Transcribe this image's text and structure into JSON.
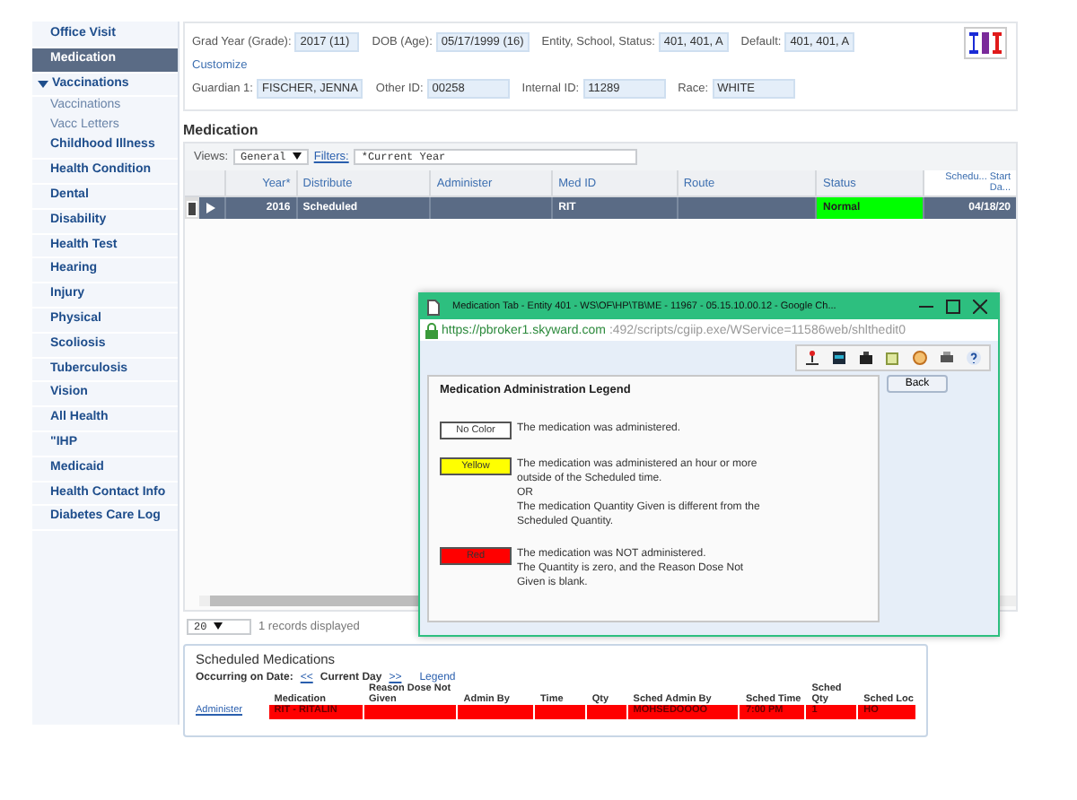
{
  "sidebar": {
    "items": [
      {
        "label": "Office Visit",
        "selected": false
      },
      {
        "label": "Medication",
        "selected": true
      },
      {
        "label": "Vaccinations",
        "selected": false,
        "expanded": true,
        "children": [
          {
            "label": "Vaccinations"
          },
          {
            "label": "Vacc Letters"
          }
        ]
      },
      {
        "label": "Childhood Illness",
        "selected": false
      },
      {
        "label": "Health Condition",
        "selected": false
      },
      {
        "label": "Dental",
        "selected": false
      },
      {
        "label": "Disability",
        "selected": false
      },
      {
        "label": "Health Test",
        "selected": false
      },
      {
        "label": "Hearing",
        "selected": false
      },
      {
        "label": "Injury",
        "selected": false
      },
      {
        "label": "Physical",
        "selected": false
      },
      {
        "label": "Scoliosis",
        "selected": false
      },
      {
        "label": "Tuberculosis",
        "selected": false
      },
      {
        "label": "Vision",
        "selected": false
      },
      {
        "label": "All Health",
        "selected": false
      },
      {
        "label": "\"IHP",
        "selected": false
      },
      {
        "label": "Medicaid",
        "selected": false
      },
      {
        "label": "Health Contact Info",
        "selected": false
      },
      {
        "label": "Diabetes Care Log",
        "selected": false
      }
    ]
  },
  "student": {
    "row_1": [
      {
        "label": "Grad Year (Grade):",
        "value": "2017 (11)"
      },
      {
        "label": "DOB (Age):",
        "value": "05/17/1999 (16)"
      },
      {
        "label": "Entity, School, Status:",
        "value": "401, 401, A"
      },
      {
        "label": "Default:",
        "value": "401, 401, A"
      }
    ],
    "customize": "Customize",
    "row_2": [
      {
        "label": "Guardian 1:",
        "value": "FISCHER, JENNA"
      },
      {
        "label": "Other ID:",
        "value": "00258"
      },
      {
        "label": "Internal ID:",
        "value": "11289"
      },
      {
        "label": "Race:",
        "value": "WHITE"
      }
    ]
  },
  "medication": {
    "title": "Medication",
    "views_label": "Views:",
    "view": "General",
    "filters_label": "Filters:",
    "filter": "*Current Year",
    "columns": [
      "Year*",
      "Distribute",
      "Administer",
      "Med ID",
      "Route",
      "Status",
      "Schedu... Start Da..."
    ],
    "rows": [
      {
        "selected": true,
        "cells": [
          {
            "text": "2016"
          },
          {
            "text": "Scheduled"
          },
          {
            "text": ""
          },
          {
            "text": "RIT"
          },
          {
            "text": ""
          },
          {
            "text": "Normal",
            "color": "#00ff00"
          },
          {
            "text": "04/18/20"
          }
        ]
      }
    ],
    "page_size": "20",
    "records": "1 records displayed"
  },
  "popup": {
    "title": "Medication Tab - Entity 401 - WS\\OF\\HP\\TB\\ME - 11967 - 05.15.10.00.12 - Google Ch...",
    "url_host": "https://pbroker1.skyward.com",
    "url_rest": ":492/scripts/cgiip.exe/WService=11586web/shlthedit0",
    "heading": "Medication Administration Legend",
    "back": "Back",
    "legend": [
      {
        "label": "No Color",
        "color": "#ffffff",
        "lines": [
          "The medication was administered."
        ]
      },
      {
        "label": "Yellow",
        "color": "#ffff00",
        "lines": [
          "The medication was administered an hour or more",
          "outside of the Scheduled time.",
          "OR",
          "The medication Quantity Given is different from the",
          "Scheduled Quantity."
        ]
      },
      {
        "label": "Red",
        "color": "#ff0000",
        "lines": [
          "The medication was NOT administered.",
          "The Quantity is zero, and the Reason Dose Not",
          "Given is blank."
        ]
      }
    ]
  },
  "scheduled": {
    "title": "Scheduled Medications",
    "occurring": "Occurring on Date:",
    "prev": "<<",
    "day": "Current Day",
    "next": ">>",
    "legend": "Legend",
    "columns": [
      "Medication",
      "Reason Dose Not Given",
      "Admin By",
      "Time",
      "Qty",
      "Sched Admin By",
      "Sched Time",
      "Sched Qty",
      "Sched Loc"
    ],
    "rows": [
      {
        "action": "Administer",
        "cells": [
          {
            "text": "RIT - RITALIN",
            "color": "#ff0000"
          },
          {
            "text": "",
            "color": "#ff0000"
          },
          {
            "text": "",
            "color": "#ff0000"
          },
          {
            "text": "",
            "color": "#ff0000"
          },
          {
            "text": "",
            "color": "#ff0000"
          },
          {
            "text": "MOHSEDOOOO",
            "color": "#ff0000"
          },
          {
            "text": "7:00 PM",
            "color": "#ff0000"
          },
          {
            "text": "1",
            "color": "#ff0000"
          },
          {
            "text": "HO",
            "color": "#ff0000"
          }
        ]
      }
    ]
  }
}
